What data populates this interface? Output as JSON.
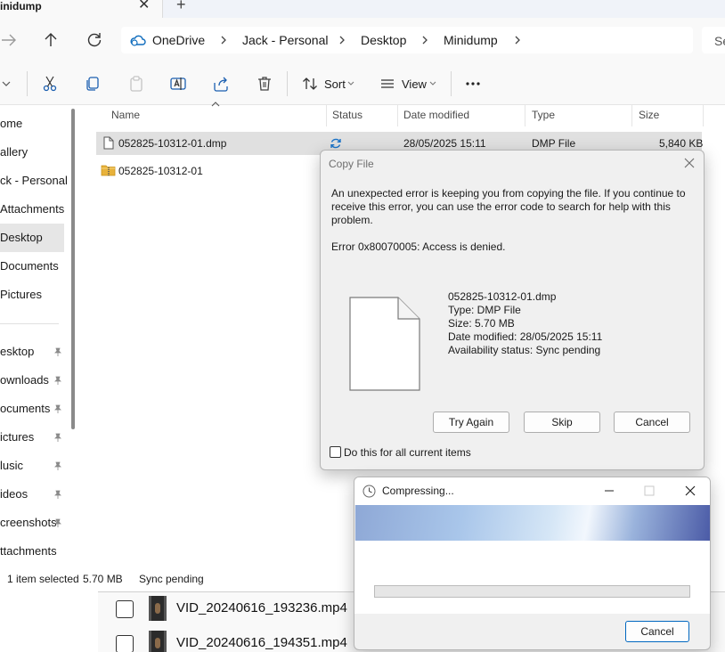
{
  "explorer": {
    "tab": {
      "title": "inidump"
    },
    "breadcrumb": [
      "OneDrive",
      "Jack - Personal",
      "Desktop",
      "Minidump"
    ],
    "search_placeholder": "Se",
    "toolbar": {
      "sort_label": "Sort",
      "view_label": "View"
    },
    "sidebar": [
      {
        "label": "ome",
        "pinned": false,
        "selected": false
      },
      {
        "label": "allery",
        "pinned": false,
        "selected": false
      },
      {
        "label": "ck - Personal",
        "pinned": false,
        "selected": false
      },
      {
        "label": "Attachments",
        "pinned": false,
        "selected": false
      },
      {
        "label": "Desktop",
        "pinned": false,
        "selected": true
      },
      {
        "label": "Documents",
        "pinned": false,
        "selected": false
      },
      {
        "label": "Pictures",
        "pinned": false,
        "selected": false
      },
      {
        "label": "esktop",
        "pinned": true,
        "selected": false
      },
      {
        "label": "ownloads",
        "pinned": true,
        "selected": false
      },
      {
        "label": "ocuments",
        "pinned": true,
        "selected": false
      },
      {
        "label": "ictures",
        "pinned": true,
        "selected": false
      },
      {
        "label": "lusic",
        "pinned": true,
        "selected": false
      },
      {
        "label": "ideos",
        "pinned": true,
        "selected": false
      },
      {
        "label": "creenshots",
        "pinned": true,
        "selected": false
      },
      {
        "label": "ttachments",
        "pinned": false,
        "selected": false
      }
    ],
    "columns": {
      "name": "Name",
      "status": "Status",
      "modified": "Date modified",
      "type": "Type",
      "size": "Size"
    },
    "files": [
      {
        "name": "052825-10312-01.dmp",
        "icon": "file-icon",
        "status": "sync-icon",
        "modified": "28/05/2025 15:11",
        "type": "DMP File",
        "size": "5,840 KB",
        "selected": true
      },
      {
        "name": "052825-10312-01",
        "icon": "zip-folder-icon",
        "status": "",
        "modified": "",
        "type": "",
        "size": "",
        "selected": false
      }
    ],
    "statusbar": {
      "count": "1 item selected",
      "size": "5.70 MB",
      "sync": "Sync pending"
    }
  },
  "background_window": {
    "rows": [
      "VID_20240616_193236.mp4",
      "VID_20240616_194351.mp4"
    ]
  },
  "copy_dialog": {
    "title": "Copy File",
    "message": "An unexpected error is keeping you from copying the file. If you continue to receive this error, you can use the error code to search for help with this problem.",
    "error": "Error 0x80070005: Access is denied.",
    "file": {
      "name": "052825-10312-01.dmp",
      "type": "Type: DMP File",
      "size": "Size: 5.70 MB",
      "modified": "Date modified: 28/05/2025 15:11",
      "availability": "Availability status: Sync pending"
    },
    "buttons": {
      "try_again": "Try Again",
      "skip": "Skip",
      "cancel": "Cancel"
    },
    "checkbox_label": "Do this for all current items"
  },
  "compress_dialog": {
    "title": "Compressing...",
    "progress": 0,
    "cancel": "Cancel"
  },
  "colors": {
    "selection": "#e0e0e0",
    "accent": "#0067c0",
    "sync_icon": "#1a73c8",
    "folder": "#e8b23a"
  }
}
